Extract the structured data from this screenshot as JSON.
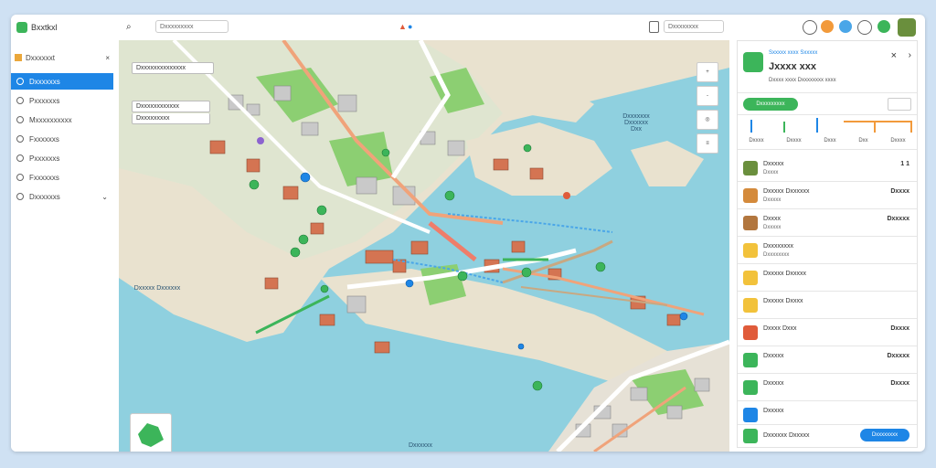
{
  "app": {
    "name": "Bxxtkxl"
  },
  "sidebar": {
    "project": "Dxxxxxxt",
    "items": [
      {
        "label": "Dxxxxxxs"
      },
      {
        "label": "Pxxxxxxs"
      },
      {
        "label": "Mxxxxxxxxxx"
      },
      {
        "label": "Fxxxxxxs"
      },
      {
        "label": "Pxxxxxxs"
      },
      {
        "label": "Fxxxxxxs"
      },
      {
        "label": "Dxxxxxxs"
      }
    ]
  },
  "topbar": {
    "search_placeholder": "Dxxxxxxxxx",
    "right_field": "Dxxxxxxxx"
  },
  "map": {
    "callouts": [
      "Dxxxxxxxxxxxxxx",
      "Dxxxxxxxxxxxx",
      "Dxxxxxxxxx"
    ],
    "water_labels": [
      "Dxxxxx Dxxxxxx",
      "Dxxxxxxx Dxxxxxx Dxx",
      "Dxxxxxx"
    ],
    "controls": [
      "+",
      "-",
      "◎",
      "≡"
    ]
  },
  "panel": {
    "title": "Jxxxx xxx",
    "subtitle": "Sxxxxx xxxx Sxxxxx",
    "desc": "Dxxxx xxxx Dxxxxxxxx xxxx",
    "badge": "Dxxxxxxxxx",
    "chart_ticks": [
      "Dxxxx",
      "Dxxxx",
      "Dxxx",
      "Dxx",
      "Dxxxx"
    ],
    "rows": [
      {
        "label": "Dxxxxx",
        "sub": "Dxxxx",
        "value": "1 1"
      },
      {
        "label": "Dxxxxx Dxxxxxx",
        "sub": "Dxxxxx",
        "value": "Dxxxx"
      },
      {
        "label": "Dxxxx",
        "sub": "Dxxxxx",
        "value": "Dxxxxx"
      },
      {
        "label": "Dxxxxxxxx",
        "sub": "Dxxxxxxxx",
        "value": ""
      },
      {
        "label": "Dxxxxx Dxxxxx",
        "sub": "",
        "value": ""
      },
      {
        "label": "Dxxxxx Dxxxx",
        "sub": "",
        "value": ""
      },
      {
        "label": "Dxxxx Dxxx",
        "sub": "",
        "value": "Dxxxx"
      },
      {
        "label": "Dxxxxx",
        "sub": "",
        "value": "Dxxxxx"
      },
      {
        "label": "Dxxxxx",
        "sub": "",
        "value": "Dxxxx"
      },
      {
        "label": "Dxxxxx",
        "sub": "",
        "value": ""
      },
      {
        "label": "Dxxxxxx Dxxxxx",
        "sub": "",
        "value": ""
      }
    ],
    "action": "Dxxxxxxxx"
  },
  "colors": {
    "accent": "#1e86e6",
    "green": "#3cb55a",
    "orange": "#f29a3b",
    "water": "#8fd0df",
    "land": "#e9e2cf"
  }
}
